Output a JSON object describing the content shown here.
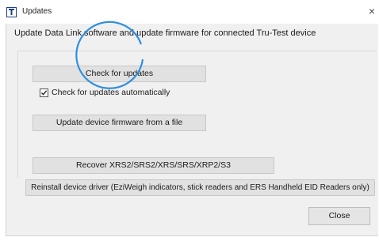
{
  "window": {
    "title": "Updates",
    "close_glyph": "×",
    "icon": "tru-test-app-icon"
  },
  "header": {
    "text": "Update Data Link software and update firmware for connected Tru-Test device"
  },
  "buttons": {
    "check_updates": "Check for updates",
    "update_firmware": "Update device firmware from a file",
    "recover": "Recover XRS2/SRS2/XRS/SRS/XRP2/S3",
    "reinstall_driver": "Reinstall device driver (EziWeigh indicators, stick readers and ERS Handheld EID Readers only)",
    "close": "Close"
  },
  "auto_check": {
    "label": "Check for updates automatically",
    "checked": true
  },
  "colors": {
    "highlight_circle": "#2f8fe0",
    "dialog_bg": "#f0f0f0",
    "button_bg": "#e1e1e1"
  }
}
